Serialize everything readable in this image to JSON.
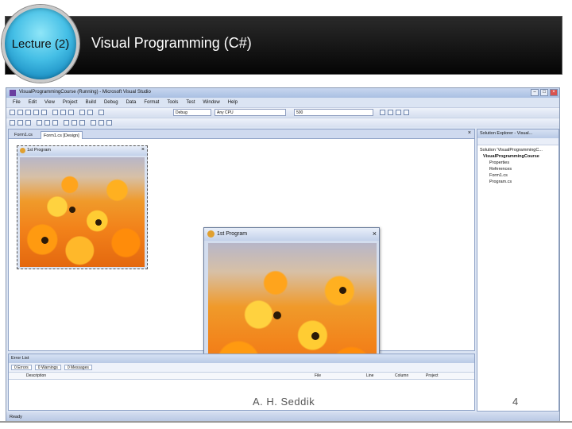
{
  "slide": {
    "badge": "Lecture (2)",
    "title": "Visual Programming (C#)",
    "author": "A. H.  Seddik",
    "page_number": "4"
  },
  "vs": {
    "window_title": "VisualProgrammingCourse (Running) - Microsoft Visual Studio",
    "menu": [
      "File",
      "Edit",
      "View",
      "Project",
      "Build",
      "Debug",
      "Data",
      "Format",
      "Tools",
      "Test",
      "Window",
      "Help"
    ],
    "toolbar": {
      "config": "Debug",
      "platform": "Any CPU",
      "value": "500"
    },
    "doc_tabs": [
      "Form1.cs",
      "Form1.cs [Design]"
    ],
    "design_form_title": "1st Program",
    "running_form_title": "1st Program",
    "solution_explorer": {
      "title": "Solution Explorer - Visual...",
      "items": [
        "Solution 'VisualProgrammingC...",
        "VisualProgrammingCourse",
        "Properties",
        "References",
        "Form1.cs",
        "Program.cs"
      ]
    },
    "error_list": {
      "title": "Error List",
      "tabs": [
        "0 Errors",
        "0 Warnings",
        "0 Messages"
      ],
      "columns": [
        "Description",
        "File",
        "Line",
        "Column",
        "Project"
      ]
    },
    "status": "Ready"
  }
}
